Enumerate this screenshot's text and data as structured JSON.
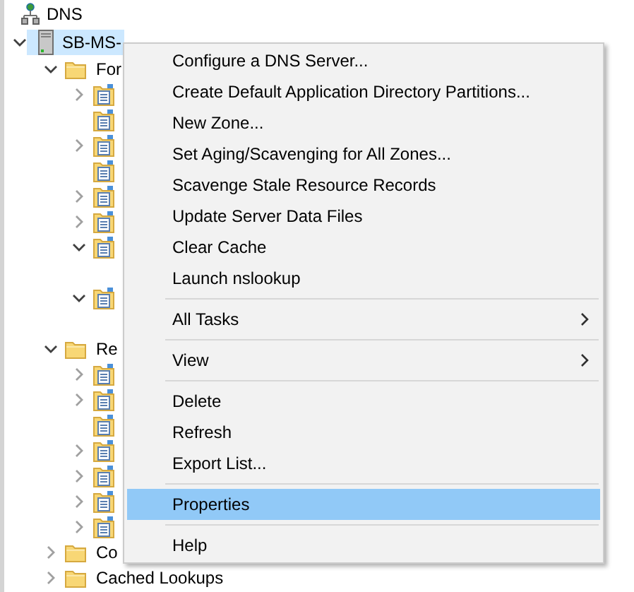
{
  "tree": {
    "label": "DNS",
    "children": [
      {
        "label": "SB-MS-",
        "selected": true,
        "expanded": true,
        "children": [
          {
            "label": "For",
            "expanded": true,
            "children": [
              {
                "expandable": true,
                "expanded": false
              },
              {
                "expandable": false
              },
              {
                "expandable": true,
                "expanded": false
              },
              {
                "expandable": false
              },
              {
                "expandable": true,
                "expanded": false
              },
              {
                "expandable": true,
                "expanded": false
              },
              {
                "expandable": true,
                "expanded": true
              },
              {
                "expandable": true,
                "expanded": true
              }
            ]
          },
          {
            "label": "Re",
            "expanded": true,
            "children": [
              {
                "expandable": true,
                "expanded": false
              },
              {
                "expandable": true,
                "expanded": false
              },
              {
                "expandable": false
              },
              {
                "expandable": true,
                "expanded": false
              },
              {
                "expandable": true,
                "expanded": false
              },
              {
                "expandable": true,
                "expanded": false
              },
              {
                "expandable": true,
                "expanded": false
              }
            ]
          },
          {
            "label": "Co",
            "expanded": false
          },
          {
            "label": "Cached Lookups",
            "expanded": false
          }
        ]
      }
    ]
  },
  "context_menu": [
    {
      "kind": "item",
      "label": "Configure a DNS Server...",
      "selected": false
    },
    {
      "kind": "item",
      "label": "Create Default Application Directory Partitions...",
      "selected": false
    },
    {
      "kind": "item",
      "label": "New Zone...",
      "selected": false
    },
    {
      "kind": "item",
      "label": "Set Aging/Scavenging for All Zones...",
      "selected": false
    },
    {
      "kind": "item",
      "label": "Scavenge Stale Resource Records",
      "selected": false
    },
    {
      "kind": "item",
      "label": "Update Server Data Files",
      "selected": false
    },
    {
      "kind": "item",
      "label": "Clear Cache",
      "selected": false
    },
    {
      "kind": "item",
      "label": "Launch nslookup",
      "selected": false
    },
    {
      "kind": "separator"
    },
    {
      "kind": "submenu",
      "label": "All Tasks",
      "selected": false
    },
    {
      "kind": "separator"
    },
    {
      "kind": "submenu",
      "label": "View",
      "selected": false
    },
    {
      "kind": "separator"
    },
    {
      "kind": "item",
      "label": "Delete",
      "selected": false
    },
    {
      "kind": "item",
      "label": "Refresh",
      "selected": false
    },
    {
      "kind": "item",
      "label": "Export List...",
      "selected": false
    },
    {
      "kind": "separator"
    },
    {
      "kind": "item",
      "label": "Properties",
      "selected": true
    },
    {
      "kind": "separator"
    },
    {
      "kind": "item",
      "label": "Help",
      "selected": false
    }
  ]
}
